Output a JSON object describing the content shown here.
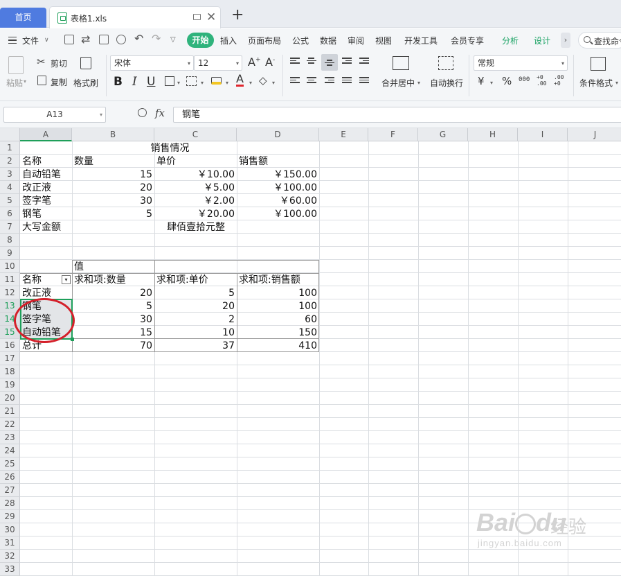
{
  "tabs": {
    "home": "首页",
    "file": "表格1.xls"
  },
  "menu": {
    "file": "文件",
    "items": [
      "开始",
      "插入",
      "页面布局",
      "公式",
      "数据",
      "审阅",
      "视图",
      "开发工具",
      "会员专享",
      "分析",
      "设计"
    ],
    "search": "查找命令"
  },
  "ribbon": {
    "paste": "粘贴",
    "cut": "剪切",
    "copy": "复制",
    "format_painter": "格式刷",
    "font_name": "宋体",
    "font_size": "12",
    "merge_center": "合并居中",
    "auto_wrap": "自动换行",
    "number_format": "常规",
    "currency": "¥",
    "percent": "%",
    "thousands": "000",
    "inc_decimal": "+0 .00",
    "dec_decimal": ".00 +0",
    "conditional_format": "条件格式"
  },
  "formula_bar": {
    "name_box": "A13",
    "fx": "fx",
    "content": "钢笔"
  },
  "columns": [
    "A",
    "B",
    "C",
    "D",
    "E",
    "F",
    "G",
    "H",
    "I",
    "J"
  ],
  "rows": [
    "1",
    "2",
    "3",
    "4",
    "5",
    "6",
    "7",
    "8",
    "9",
    "10",
    "11",
    "12",
    "13",
    "14",
    "15",
    "16",
    "17",
    "18",
    "19",
    "20",
    "21",
    "22",
    "23",
    "24",
    "25",
    "26",
    "27",
    "28",
    "29",
    "30",
    "31",
    "32",
    "33"
  ],
  "sheet": {
    "title": "销售情况",
    "headers": [
      "名称",
      "数量",
      "单价",
      "销售额"
    ],
    "data": [
      {
        "name": "自动铅笔",
        "qty": "15",
        "price": "￥10.00",
        "amount": "￥150.00"
      },
      {
        "name": "改正液",
        "qty": "20",
        "price": "￥5.00",
        "amount": "￥100.00"
      },
      {
        "name": "签字笔",
        "qty": "30",
        "price": "￥2.00",
        "amount": "￥60.00"
      },
      {
        "name": "钢笔",
        "qty": "5",
        "price": "￥20.00",
        "amount": "￥100.00"
      }
    ],
    "capital_label": "大写金额",
    "capital_value": "肆佰壹拾元整"
  },
  "pivot": {
    "values_label": "值",
    "headers": [
      "名称",
      "求和项:数量",
      "求和项:单价",
      "求和项:销售额"
    ],
    "rows": [
      {
        "name": "改正液",
        "qty": "20",
        "price": "5",
        "amount": "100"
      },
      {
        "name": "钢笔",
        "qty": "5",
        "price": "20",
        "amount": "100"
      },
      {
        "name": "签字笔",
        "qty": "30",
        "price": "2",
        "amount": "60"
      },
      {
        "name": "自动铅笔",
        "qty": "15",
        "price": "10",
        "amount": "150"
      }
    ],
    "total": {
      "name": "总计",
      "qty": "70",
      "price": "37",
      "amount": "410"
    }
  },
  "watermark": {
    "brand": "Bai",
    "brand2": "du",
    "cn": "经验",
    "url": "jingyan.baidu.com"
  },
  "colors": {
    "accent": "#1e9f5a",
    "tab_blue": "#4f7be0",
    "start_green": "#2fb37c",
    "annotation_red": "#d4202a"
  }
}
